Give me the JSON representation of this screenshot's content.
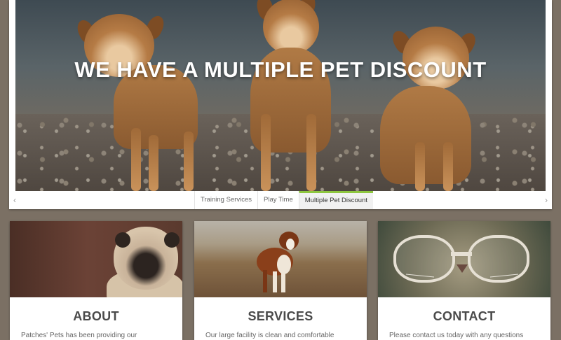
{
  "hero": {
    "title": "WE HAVE A MULTIPLE PET DISCOUNT",
    "prev_icon": "chevron-left-icon",
    "next_icon": "chevron-right-icon",
    "prev_glyph": "‹",
    "next_glyph": "›",
    "tabs": [
      {
        "label": "Training Services",
        "active": false
      },
      {
        "label": "Play Time",
        "active": false
      },
      {
        "label": "Multiple Pet Discount",
        "active": true
      }
    ],
    "active_tab_color": "#8dc63f"
  },
  "cards": [
    {
      "title": "ABOUT",
      "text": "Patches' Pets has been providing our",
      "image": "pug-photo"
    },
    {
      "title": "SERVICES",
      "text": "Our large facility is clean and comfortable",
      "image": "dog-in-field-photo"
    },
    {
      "title": "CONTACT",
      "text": "Please contact us today with any questions",
      "image": "cat-with-glasses-photo"
    }
  ],
  "colors": {
    "page_background": "#7b7064",
    "card_title": "#4a4a4a"
  }
}
